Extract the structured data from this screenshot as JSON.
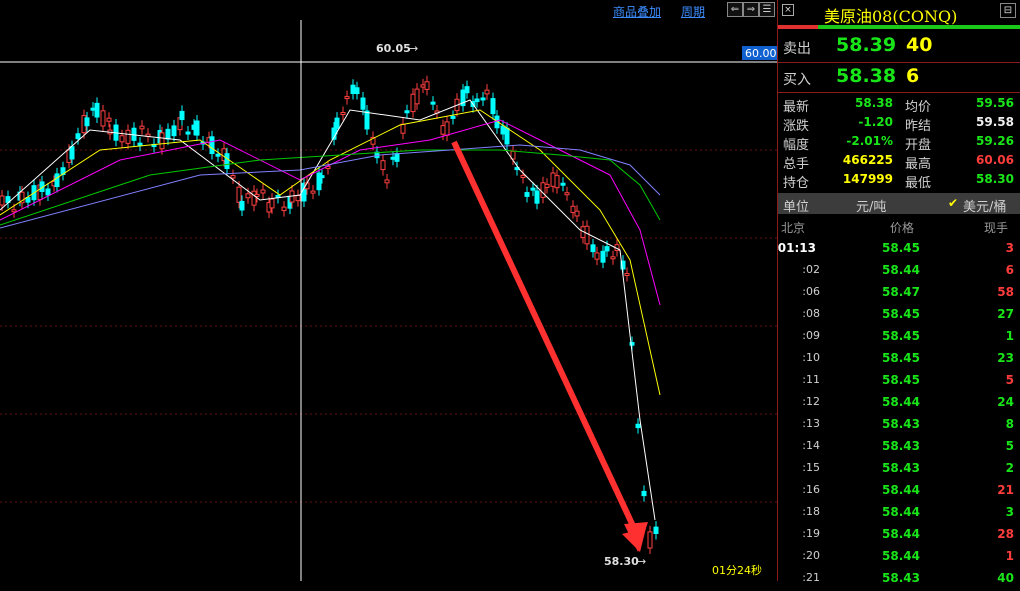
{
  "toolbar": {
    "overlay_label": "商品叠加",
    "period_label": "周期"
  },
  "chart": {
    "high_label": "60.05",
    "low_label": "58.30",
    "cursor_price_label": "60.00",
    "timer_label": "01分24秒",
    "ma_colors": {
      "ma5": "#ffffff",
      "ma10": "#ffff00",
      "ma20": "#ff00ff",
      "ma30": "#00c800",
      "ma60": "#8080ff"
    }
  },
  "chart_data": {
    "type": "candlestick",
    "title": "",
    "y_high": 60.05,
    "y_low": 58.3,
    "annotations": [
      "60.05",
      "58.30",
      "60.00"
    ]
  },
  "quote": {
    "title": "美原油08(CONQ)",
    "sell_label": "卖出",
    "sell_price": "58.39",
    "sell_qty": "40",
    "buy_label": "买入",
    "buy_price": "58.38",
    "buy_qty": "6",
    "stats": [
      {
        "l1": "最新",
        "v1": "58.38",
        "c1": "green",
        "l2": "均价",
        "v2": "59.56",
        "c2": "green"
      },
      {
        "l1": "涨跌",
        "v1": "-1.20",
        "c1": "green",
        "l2": "昨结",
        "v2": "59.58",
        "c2": "white"
      },
      {
        "l1": "幅度",
        "v1": "-2.01%",
        "c1": "green",
        "l2": "开盘",
        "v2": "59.26",
        "c2": "green"
      },
      {
        "l1": "总手",
        "v1": "466225",
        "c1": "yellow",
        "l2": "最高",
        "v2": "60.06",
        "c2": "red"
      },
      {
        "l1": "持仓",
        "v1": "147999",
        "c1": "yellow",
        "l2": "最低",
        "v2": "58.30",
        "c2": "green"
      }
    ],
    "unit_label": "单位",
    "unit_value": "元/吨",
    "unit_check": "✔",
    "unit_alt": "美元/桶",
    "tick_header": {
      "time": "北京",
      "price": "价格",
      "vol": "现手"
    },
    "ticks": [
      {
        "time": "01:13",
        "price": "58.45",
        "vol": "3",
        "c": "red"
      },
      {
        "time": ":02",
        "price": "58.44",
        "vol": "6",
        "c": "red"
      },
      {
        "time": ":06",
        "price": "58.47",
        "vol": "58",
        "c": "red"
      },
      {
        "time": ":08",
        "price": "58.45",
        "vol": "27",
        "c": "green"
      },
      {
        "time": ":09",
        "price": "58.45",
        "vol": "1",
        "c": "green"
      },
      {
        "time": ":10",
        "price": "58.45",
        "vol": "23",
        "c": "green"
      },
      {
        "time": ":11",
        "price": "58.45",
        "vol": "5",
        "c": "red"
      },
      {
        "time": ":12",
        "price": "58.44",
        "vol": "24",
        "c": "green"
      },
      {
        "time": ":13",
        "price": "58.43",
        "vol": "8",
        "c": "green"
      },
      {
        "time": ":14",
        "price": "58.43",
        "vol": "5",
        "c": "green"
      },
      {
        "time": ":15",
        "price": "58.43",
        "vol": "2",
        "c": "green"
      },
      {
        "time": ":16",
        "price": "58.44",
        "vol": "21",
        "c": "red"
      },
      {
        "time": ":18",
        "price": "58.44",
        "vol": "3",
        "c": "green"
      },
      {
        "time": ":19",
        "price": "58.44",
        "vol": "28",
        "c": "red"
      },
      {
        "time": ":20",
        "price": "58.44",
        "vol": "1",
        "c": "red"
      },
      {
        "time": ":21",
        "price": "58.43",
        "vol": "40",
        "c": "green"
      }
    ]
  }
}
